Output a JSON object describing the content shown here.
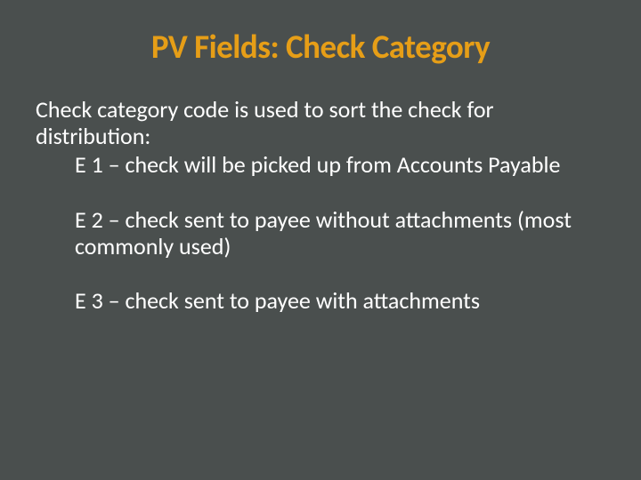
{
  "title": "PV Fields: Check Category",
  "intro": "Check category code is used to sort the check for distribution:",
  "items": [
    "E 1 – check will be picked up from Accounts Payable",
    "E 2 – check sent to payee without attachments (most commonly used)",
    "E 3 – check sent to payee with attachments"
  ]
}
